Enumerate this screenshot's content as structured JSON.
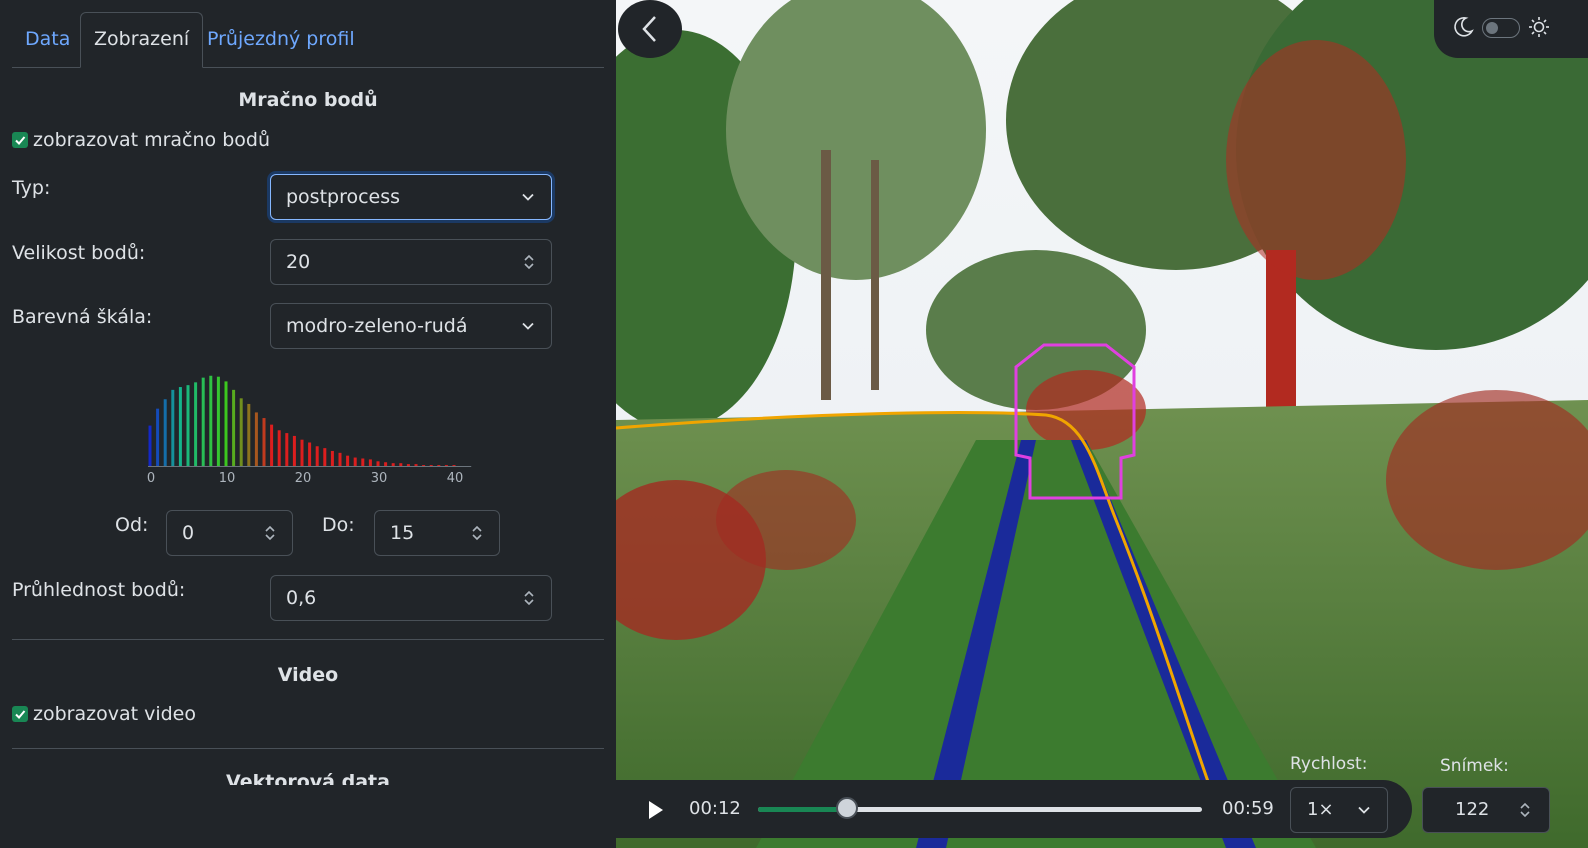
{
  "tabs": [
    {
      "label": "Data",
      "active": false
    },
    {
      "label": "Zobrazení",
      "active": true
    },
    {
      "label": "Průjezdný profil",
      "active": false
    }
  ],
  "point_cloud": {
    "section_title": "Mračno bodů",
    "show_label": "zobrazovat mračno bodů",
    "show_checked": true,
    "type_label": "Typ:",
    "type_value": "postprocess",
    "size_label": "Velikost bodů:",
    "size_value": "20",
    "scale_label": "Barevná škála:",
    "scale_value": "modro-zeleno-rudá",
    "histogram": {
      "tick_labels": [
        "0",
        "10",
        "20",
        "30",
        "40"
      ],
      "values": [
        0.43,
        0.61,
        0.71,
        0.81,
        0.84,
        0.86,
        0.89,
        0.94,
        0.96,
        0.95,
        0.9,
        0.81,
        0.72,
        0.66,
        0.57,
        0.51,
        0.44,
        0.38,
        0.35,
        0.32,
        0.28,
        0.25,
        0.21,
        0.19,
        0.16,
        0.14,
        0.11,
        0.09,
        0.08,
        0.07,
        0.05,
        0.04,
        0.03,
        0.03,
        0.02,
        0.02,
        0.01,
        0.01,
        0.01,
        0.01,
        0.01,
        0.0,
        0.0
      ]
    },
    "from_label": "Od:",
    "from_value": "0",
    "to_label": "Do:",
    "to_value": "15",
    "opacity_label": "Průhlednost bodů:",
    "opacity_value": "0,6"
  },
  "video": {
    "section_title": "Video",
    "show_label": "zobrazovat video",
    "show_checked": true
  },
  "vector": {
    "section_title": "Vektorová data"
  },
  "player": {
    "current_time": "00:12",
    "total_time": "00:59",
    "progress": 0.2,
    "speed_label": "Rychlost:",
    "speed_value": "1×",
    "frame_label": "Snímek:",
    "frame_value": "122"
  },
  "theme": {
    "dark_mode": false
  },
  "colors": {
    "accent": "#198754",
    "link": "#6ea8fe",
    "profile_outline": "#e040e0",
    "track_line": "#f0a500"
  }
}
